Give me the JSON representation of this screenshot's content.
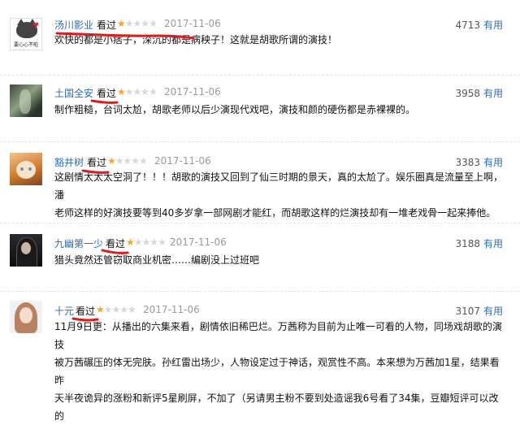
{
  "reviews": [
    {
      "user": "汤川影业",
      "watched_label": "看过",
      "rating": 1,
      "date": "2017-11-06",
      "votes": "4713",
      "useful_label": "有用",
      "avatar_text": "要心心不啦",
      "avatar_icon": "cartoon-cat-avatar",
      "lines": [
        "欢快的都是小痞子，深沉的都是病秧子！这就是胡歌所谓的演技！"
      ]
    },
    {
      "user": "土国全安",
      "watched_label": "看过",
      "rating": 1,
      "date": "2017-11-06",
      "votes": "3958",
      "useful_label": "有用",
      "avatar_icon": "dark-figure-avatar",
      "lines": [
        "制作粗糙，台词太尬，胡歌老师以后少演现代戏吧，演技和颜的硬伤都是赤裸裸的。"
      ]
    },
    {
      "user": "豁井树",
      "watched_label": "看过",
      "rating": 1,
      "date": "2017-11-06",
      "votes": "3383",
      "useful_label": "有用",
      "avatar_icon": "orange-cat-avatar",
      "lines": [
        "这剧情太太太空洞了！！！胡歌的演技又回到了仙三时期的景天，真的太尬了。娱乐圈真是流量至上啊，潘",
        "老师这样的好演技要等到40多岁拿一部网剧才能红，而胡歌这样的烂演技却有一堆老戏骨一起来捧他。"
      ]
    },
    {
      "user": "九幽第一少",
      "watched_label": "看过",
      "rating": 1,
      "date": "2017-11-06",
      "votes": "3188",
      "useful_label": "有用",
      "avatar_icon": "dark-hair-avatar",
      "lines": [
        "猎头竟然还管窃取商业机密……编剧没上过班吧"
      ]
    },
    {
      "user": "十元",
      "watched_label": "看过",
      "rating": 1,
      "date": "2017-11-06",
      "votes": "3107",
      "useful_label": "有用",
      "avatar_icon": "woman-portrait-avatar",
      "lines": [
        "11月9日更：从播出的六集来看，剧情依旧稀巴烂。万茜称为目前为止唯一可看的人物，同场戏胡歌的演技",
        "被万茜碾压的体无完肤。孙红雷出场少，人物设定过于神话，观赏性不高。本来想为万茜加1星，结果看昨",
        "天半夜诡异的涨粉和新评5星刷屏，不加了（另请男主粉不要到处造谣我6号看了34集，豆瓣短评可以改的"
      ]
    }
  ],
  "colors": {
    "link": "#2a6db3",
    "star_on": "#f5a623",
    "star_off": "#d7d7d7",
    "date": "#999999",
    "annotation": "#e0191a"
  },
  "icons": {
    "star": "star-icon"
  }
}
